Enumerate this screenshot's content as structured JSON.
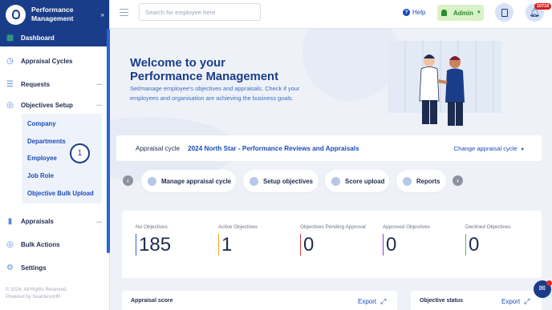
{
  "brand": {
    "name": "Performance Management",
    "logo_icon": "person-icon"
  },
  "sidebar": {
    "items": [
      {
        "label": "Dashboard",
        "icon": "dashboard-grid-icon",
        "active": true
      },
      {
        "label": "Appraisal Cycles",
        "icon": "cycle-clock-icon"
      },
      {
        "label": "Requests",
        "icon": "list-icon"
      },
      {
        "label": "Objectives Setup",
        "icon": "target-icon"
      },
      {
        "label": "Appraisals",
        "icon": "book-icon"
      },
      {
        "label": "Bulk Actions",
        "icon": "target-icon"
      },
      {
        "label": "Settings",
        "icon": "gear-icon"
      }
    ],
    "sub_items": [
      "Company",
      "Departments",
      "Employee",
      "Job Role",
      "Objective Bulk Upload"
    ],
    "footer_line1": "© 2024. All Rights Reserved.",
    "footer_line2": "Powered by SeamlessHR"
  },
  "topbar": {
    "search_placeholder": "Search for employee here",
    "help_label": "Help",
    "admin_label": "Admin",
    "notification_count": "10716"
  },
  "welcome": {
    "title": "Welcome to your Performance Management",
    "subtitle": "Set/manage employee's objectives and appraisals. Check if your employees and organisation are achieving the business goals."
  },
  "appraisal_cycle": {
    "label": "Appraisal cycle",
    "name": "2024 North Star - Performance Reviews and Appraisals",
    "change_label": "Change appraisal cycle"
  },
  "quick_actions": [
    "Manage appraisal cycle",
    "Setup objectives",
    "Score upload",
    "Reports"
  ],
  "stats": [
    {
      "label": "No Objectives",
      "value": "185",
      "color": "#2a63d4"
    },
    {
      "label": "Active Objectives",
      "value": "1",
      "color": "#f0a020"
    },
    {
      "label": "Objectives Pending Approval",
      "value": "0",
      "color": "#d63a3a"
    },
    {
      "label": "Approved Objectives",
      "value": "0",
      "color": "#8a3ad6"
    },
    {
      "label": "Declined Objectives",
      "value": "0",
      "color": "#3ac27a"
    }
  ],
  "cards": [
    {
      "title": "Appraisal score",
      "export": "Export"
    },
    {
      "title": "Objective status",
      "export": "Export"
    }
  ],
  "step_marker": "1"
}
